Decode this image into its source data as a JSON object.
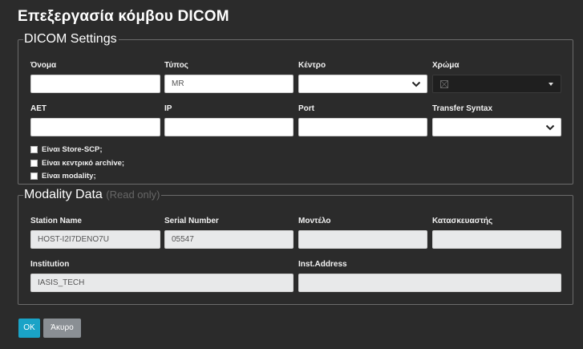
{
  "dialog": {
    "title": "Επεξεργασία κόμβου DICOM"
  },
  "dicom_settings": {
    "legend": "DICOM Settings",
    "name_label": "Όνομα",
    "name_value": "",
    "type_label": "Τύπος",
    "type_value": "MR",
    "center_label": "Κέντρο",
    "center_value": "",
    "color_label": "Χρώμα",
    "color_value": "",
    "aet_label": "AET",
    "aet_value": "",
    "ip_label": "IP",
    "ip_value": "",
    "port_label": "Port",
    "port_value": "",
    "transfer_label": "Transfer Syntax",
    "transfer_value": "",
    "checkboxes": [
      {
        "label": "Είναι Store-SCP;",
        "checked": false
      },
      {
        "label": "Είναι κεντρικό archive;",
        "checked": false
      },
      {
        "label": "Είναι modality;",
        "checked": false
      }
    ]
  },
  "modality_data": {
    "legend": "Modality Data",
    "readonly_note": "(Read only)",
    "station_label": "Station Name",
    "station_value": "HOST-I2I7DENO7U",
    "serial_label": "Serial Number",
    "serial_value": "05547",
    "model_label": "Μοντέλο",
    "model_value": "",
    "manufacturer_label": "Κατασκευαστής",
    "manufacturer_value": "",
    "institution_label": "Institution",
    "institution_value": "IASIS_TECH",
    "inst_address_label": "Inst.Address",
    "inst_address_value": ""
  },
  "buttons": {
    "ok": "OK",
    "cancel": "Άκυρο"
  },
  "icons": {
    "dropdown": "chevron-down-icon",
    "color_dropdown": "caret-down-icon",
    "color_empty": "empty-color-icon"
  },
  "colors": {
    "background": "#2b2b2b",
    "primary_button": "#1aa3c7",
    "secondary_button": "#8a8f94"
  }
}
